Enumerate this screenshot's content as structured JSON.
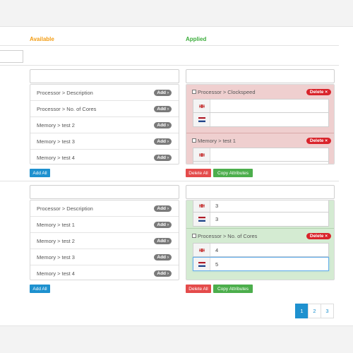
{
  "columns": {
    "available": "Available",
    "applied": "Applied"
  },
  "colors": {
    "available": "#f39c12",
    "applied": "#3cad3c",
    "delete": "#d9242b",
    "add_all": "#1e91cf"
  },
  "icons": {
    "en_flag": "en-flag-icon",
    "nl_flag": "nl-flag-icon"
  },
  "row1": {
    "available": [
      {
        "label": "Processor > Description",
        "button": "Add ›"
      },
      {
        "label": "Processor > No. of Cores",
        "button": "Add ›"
      },
      {
        "label": "Memory > test 2",
        "button": "Add ›"
      },
      {
        "label": "Memory > test 3",
        "button": "Add ›"
      },
      {
        "label": "Memory > test 4",
        "button": "Add ›"
      }
    ],
    "applied": [
      {
        "title": "Processor > Clockspeed",
        "delete": "Delete ×",
        "values": [
          "",
          ""
        ]
      },
      {
        "title": "Memory > test 1",
        "delete": "Delete ×",
        "values": [
          "",
          ""
        ]
      }
    ],
    "add_all": "Add All",
    "delete_all": "Delete All",
    "copy_attributes": "Copy Attributes"
  },
  "row2": {
    "available": [
      {
        "label": "Processor > Description",
        "button": "Add ›"
      },
      {
        "label": "Memory > test 1",
        "button": "Add ›"
      },
      {
        "label": "Memory > test 2",
        "button": "Add ›"
      },
      {
        "label": "Memory > test 3",
        "button": "Add ›"
      },
      {
        "label": "Memory > test 4",
        "button": "Add ›"
      }
    ],
    "applied_top_values": [
      "3",
      "3"
    ],
    "applied": [
      {
        "title": "Processor > No. of Cores",
        "delete": "Delete ×",
        "values": [
          "4",
          "5"
        ]
      }
    ],
    "add_all": "Add All",
    "delete_all": "Delete All",
    "copy_attributes": "Copy Attributes"
  },
  "pagination": {
    "pages": [
      "1",
      "2",
      "3"
    ],
    "active": "1"
  }
}
